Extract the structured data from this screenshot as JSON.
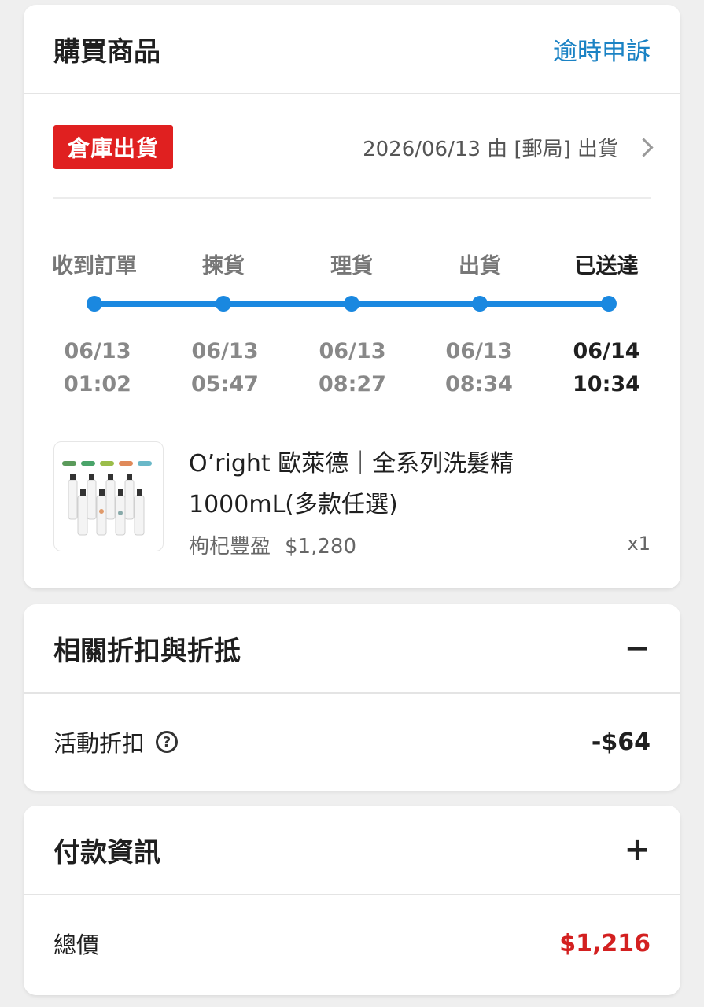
{
  "order_card": {
    "title": "購買商品",
    "appeal_link": "逾時申訴",
    "badge": "倉庫出貨",
    "shipping_info": "2026/06/13 由 [郵局] 出貨",
    "steps": [
      {
        "label": "收到訂單",
        "date": "06/13",
        "time": "01:02",
        "current": false
      },
      {
        "label": "揀貨",
        "date": "06/13",
        "time": "05:47",
        "current": false
      },
      {
        "label": "理貨",
        "date": "06/13",
        "time": "08:27",
        "current": false
      },
      {
        "label": "出貨",
        "date": "06/13",
        "time": "08:34",
        "current": false
      },
      {
        "label": "已送達",
        "date": "06/14",
        "time": "10:34",
        "current": true
      }
    ],
    "product": {
      "name": "O’right 歐萊德｜全系列洗髮精 1000mL(多款任選)",
      "variant": "枸杞豐盈",
      "price": "$1,280",
      "qty": "x1"
    }
  },
  "discount_card": {
    "title": "相關折扣與折抵",
    "toggle": "−",
    "row_label": "活動折扣",
    "row_value": "-$64"
  },
  "payment_card": {
    "title": "付款資訊",
    "toggle": "+",
    "row_label": "總價",
    "row_value": "$1,216"
  },
  "colors": {
    "accent_blue": "#1a88e0",
    "link_blue": "#1a82c4",
    "badge_red": "#e02020",
    "total_red": "#d32020"
  }
}
